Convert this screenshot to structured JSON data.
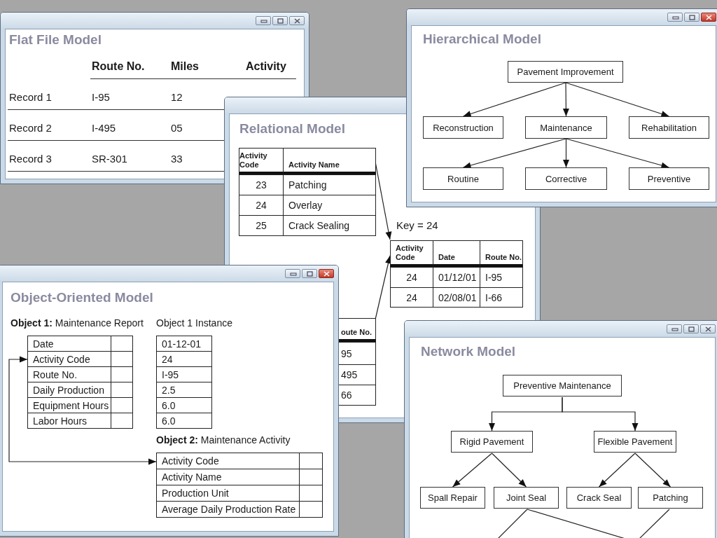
{
  "windows": [
    {
      "kind": "flat_file",
      "title": "Flat File Model",
      "close_highlighted": false,
      "columns": [
        "Route No.",
        "Miles",
        "Activity"
      ],
      "rows": [
        {
          "label": "Record 1",
          "cells": [
            "I-95",
            "12"
          ]
        },
        {
          "label": "Record 2",
          "cells": [
            "I-495",
            "05"
          ]
        },
        {
          "label": "Record 3",
          "cells": [
            "SR-301",
            "33"
          ]
        }
      ]
    },
    {
      "kind": "relational",
      "title": "Relational Model",
      "table": {
        "columns": [
          "Activity Code",
          "Activity Name"
        ],
        "rows": [
          [
            "23",
            "Patching"
          ],
          [
            "24",
            "Overlay"
          ],
          [
            "25",
            "Crack Sealing"
          ]
        ]
      },
      "key_label": "Key = 24",
      "linked_table": {
        "columns": [
          "Activity Code",
          "Date",
          "Route No."
        ],
        "rows": [
          [
            "24",
            "01/12/01",
            "I-95"
          ],
          [
            "24",
            "02/08/01",
            "I-66"
          ]
        ]
      },
      "partial_table": {
        "columns": [
          "oute No."
        ],
        "rows": [
          [
            "95"
          ],
          [
            "495"
          ],
          [
            "66"
          ]
        ]
      }
    },
    {
      "kind": "tree",
      "title": "Hierarchical Model",
      "close_highlighted": true,
      "root": {
        "label": "Pavement Improvement",
        "children": [
          {
            "label": "Reconstruction"
          },
          {
            "label": "Maintenance",
            "children": [
              {
                "label": "Routine"
              },
              {
                "label": "Corrective"
              },
              {
                "label": "Preventive"
              }
            ]
          },
          {
            "label": "Rehabilitation"
          }
        ]
      }
    },
    {
      "kind": "object",
      "title": "Object-Oriented Model",
      "close_highlighted": true,
      "object1": {
        "label": "**Object 1:** Maintenance Report",
        "fields": [
          "Date",
          "Activity Code",
          "Route No.",
          "Daily Production",
          "Equipment Hours",
          "Labor Hours"
        ]
      },
      "instance": {
        "label": "Object 1 Instance",
        "values": [
          "01-12-01",
          "24",
          "I-95",
          "2.5",
          "6.0",
          "6.0"
        ]
      },
      "object2": {
        "label": "**Object 2:** Maintenance Activity",
        "fields": [
          "Activity Code",
          "Activity Name",
          "Production Unit",
          "Average Daily Production Rate"
        ]
      }
    },
    {
      "kind": "network",
      "title": "Network Model",
      "close_highlighted": false,
      "root": {
        "label": "Preventive Maintenance",
        "children": [
          {
            "label": "Rigid Pavement",
            "children": [
              {
                "label": "Spall Repair"
              },
              {
                "label": "Joint Seal"
              }
            ]
          },
          {
            "label": "Flexible Pavement",
            "children": [
              {
                "label": "Crack Seal"
              },
              {
                "label": "Patching"
              }
            ]
          }
        ]
      }
    }
  ]
}
